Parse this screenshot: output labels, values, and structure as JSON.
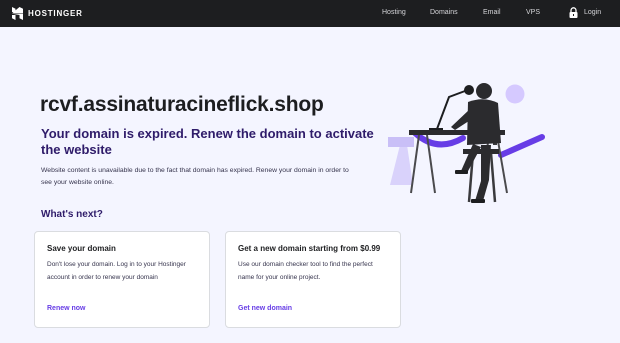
{
  "brand": {
    "name": "HOSTINGER",
    "logo_icon": "hostinger-h-icon"
  },
  "nav": {
    "links": [
      "Hosting",
      "Domains",
      "Email",
      "VPS"
    ],
    "login_label": "Login",
    "login_icon": "lock-icon"
  },
  "main": {
    "domain": "rcvf.assinaturacineflick.shop",
    "headline": "Your domain is expired. Renew the domain to activate the website",
    "description": "Website content is unavailable due to the fact that domain has expired. Renew your domain in order to see your website online.",
    "next_title": "What's next?"
  },
  "cards": [
    {
      "title": "Save your domain",
      "text": "Don't lose your domain. Log in to your Hostinger account in order to renew your domain",
      "link": "Renew now"
    },
    {
      "title": "Get a new domain starting from $0.99",
      "text": "Use our domain checker tool to find the perfect name for your online project.",
      "link": "Get new domain"
    }
  ],
  "colors": {
    "topbar": "#1d1e20",
    "page_background": "#f4f5ff",
    "accent": "#673de6",
    "heading": "#2f1c6a"
  }
}
